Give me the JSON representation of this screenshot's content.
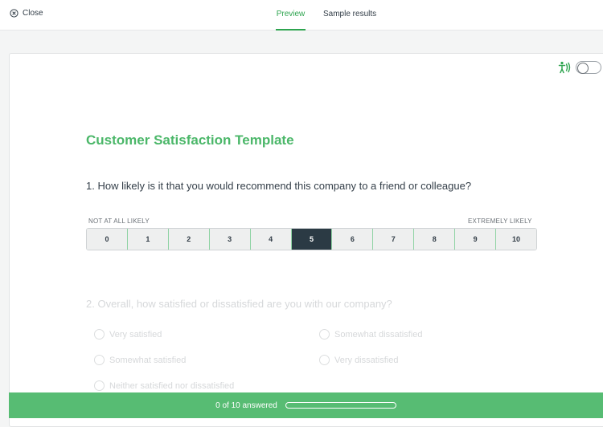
{
  "topbar": {
    "close_label": "Close",
    "tabs": [
      {
        "label": "Preview",
        "active": true
      },
      {
        "label": "Sample results",
        "active": false
      }
    ]
  },
  "accessibility": {
    "icon": "accessibility-icon",
    "toggle_on": false
  },
  "survey": {
    "title": "Customer Satisfaction Template",
    "q1": {
      "text": "1. How likely is it that you would recommend this company to a friend or colleague?",
      "low_label": "NOT AT ALL LIKELY",
      "high_label": "EXTREMELY LIKELY",
      "options": [
        "0",
        "1",
        "2",
        "3",
        "4",
        "5",
        "6",
        "7",
        "8",
        "9",
        "10"
      ],
      "selected": "5"
    },
    "q2": {
      "text": "2. Overall, how satisfied or dissatisfied are you with our company?",
      "options": [
        "Very satisfied",
        "Somewhat dissatisfied",
        "Somewhat satisfied",
        "Very dissatisfied",
        "Neither satisfied nor dissatisfied"
      ]
    }
  },
  "progress": {
    "text": "0 of 10 answered",
    "fraction": 0.0
  },
  "colors": {
    "accent": "#4bb769",
    "footer": "#57bc73",
    "selected_cell": "#2b3a44"
  }
}
